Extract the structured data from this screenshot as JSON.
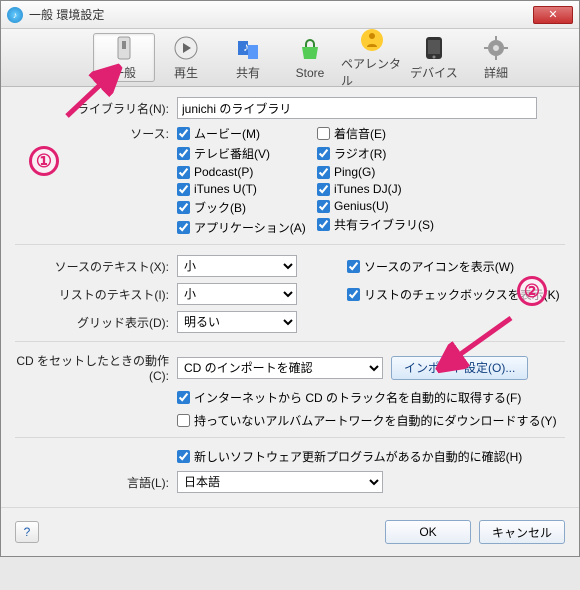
{
  "window": {
    "title": "一般 環境設定"
  },
  "toolbar": [
    {
      "label": "一般"
    },
    {
      "label": "再生"
    },
    {
      "label": "共有"
    },
    {
      "label": "Store"
    },
    {
      "label": "ペアレンタル"
    },
    {
      "label": "デバイス"
    },
    {
      "label": "詳細"
    }
  ],
  "library": {
    "label": "ライブラリ名(N):",
    "value": "junichi のライブラリ"
  },
  "source_label": "ソース:",
  "sources_col1": [
    {
      "label": "ムービー(M)",
      "checked": true
    },
    {
      "label": "テレビ番組(V)",
      "checked": true
    },
    {
      "label": "Podcast(P)",
      "checked": true
    },
    {
      "label": "iTunes U(T)",
      "checked": true
    },
    {
      "label": "ブック(B)",
      "checked": true
    },
    {
      "label": "アプリケーション(A)",
      "checked": true
    }
  ],
  "sources_col2": [
    {
      "label": "着信音(E)",
      "checked": false
    },
    {
      "label": "ラジオ(R)",
      "checked": true
    },
    {
      "label": "Ping(G)",
      "checked": true
    },
    {
      "label": "iTunes DJ(J)",
      "checked": true
    },
    {
      "label": "Genius(U)",
      "checked": true
    },
    {
      "label": "共有ライブラリ(S)",
      "checked": true
    }
  ],
  "text_rows": {
    "src_text": {
      "label": "ソースのテキスト(X):",
      "value": "小"
    },
    "list_text": {
      "label": "リストのテキスト(I):",
      "value": "小"
    },
    "grid": {
      "label": "グリッド表示(D):",
      "value": "明るい"
    }
  },
  "show_icons": {
    "label": "ソースのアイコンを表示(W)",
    "checked": true
  },
  "show_checkboxes": {
    "label": "リストのチェックボックスを表示(K)",
    "checked": true
  },
  "cd": {
    "label": "CD をセットしたときの動作(C):",
    "value": "CD のインポートを確認",
    "import_btn": "インポート設定(O)..."
  },
  "cd_opts": [
    {
      "label": "インターネットから CD のトラック名を自動的に取得する(F)",
      "checked": true
    },
    {
      "label": "持っていないアルバムアートワークを自動的にダウンロードする(Y)",
      "checked": false
    }
  ],
  "update_check": {
    "label": "新しいソフトウェア更新プログラムがあるか自動的に確認(H)",
    "checked": true
  },
  "language": {
    "label": "言語(L):",
    "value": "日本語"
  },
  "footer": {
    "help": "?",
    "ok": "OK",
    "cancel": "キャンセル"
  },
  "annotations": {
    "one": "①",
    "two": "②"
  }
}
